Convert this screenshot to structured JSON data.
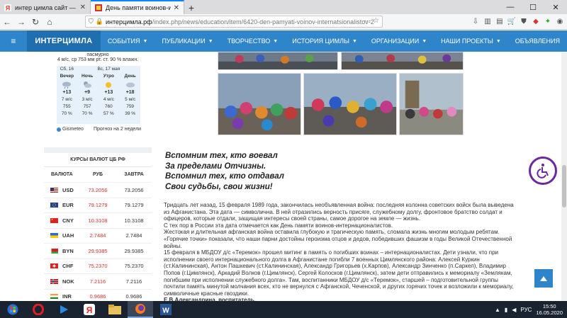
{
  "browser": {
    "tabs": [
      {
        "title": "интер цимла сайт — Яндекс: н",
        "active": false
      },
      {
        "title": "День памяти воинов-интернац",
        "active": true
      }
    ],
    "url_host": "интерцимла.рф",
    "url_path": "/index.php/news/education/item/6420-den-pamyati-voinov-internatsionalistov-2"
  },
  "site_menu": {
    "brand": "ИНТЕРЦИМЛА",
    "items": [
      "СОБЫТИЯ",
      "ПУБЛИКАЦИИ",
      "ТВОРЧЕСТВО",
      "ИСТОРИЯ ЦИМЛЫ",
      "ОРГАНИЗАЦИИ",
      "НАШИ ПРОЕКТЫ",
      "ОБЪЯВЛЕНИЯ"
    ]
  },
  "weather": {
    "now_condition": "пасмурно",
    "now_details": "4 м/с, ср   753 мм рт. ст.   90 % влажн.",
    "day1": "Сб, 16",
    "day2": "Вс, 17 мая",
    "columns": [
      {
        "period": "Вечер",
        "temp": "+13",
        "wind": "7 м/с",
        "pressure": "755",
        "humidity": "70 %",
        "icon": "cloud-rain-icon"
      },
      {
        "period": "Ночь",
        "temp": "+9",
        "wind": "3 м/с",
        "pressure": "757",
        "humidity": "70 %",
        "icon": "cloud-moon-icon"
      },
      {
        "period": "Утро",
        "temp": "+13",
        "wind": "4 м/с",
        "pressure": "760",
        "humidity": "57 %",
        "icon": "sun-icon"
      },
      {
        "period": "День",
        "temp": "+18",
        "wind": "5 м/с",
        "pressure": "759",
        "humidity": "39 %",
        "icon": "cloud-icon"
      }
    ],
    "provider": "Gismeteo",
    "forecast_link": "Прогноз на 2 недели"
  },
  "currency": {
    "title": "КУРСЫ ВАЛЮТ ЦБ РФ",
    "headers": [
      "ВАЛЮТА",
      "РУБ",
      "ЗАВТРА"
    ],
    "rows": [
      {
        "code": "USD",
        "rub": "73.2056",
        "tomorrow": "73.2056"
      },
      {
        "code": "EUR",
        "rub": "79.1279",
        "tomorrow": "79.1279"
      },
      {
        "code": "CNY",
        "rub": "10.3108",
        "tomorrow": "10.3108"
      },
      {
        "code": "UAH",
        "rub": "2.7484",
        "tomorrow": "2.7484"
      },
      {
        "code": "BYN",
        "rub": "29.9385",
        "tomorrow": "29.9385"
      },
      {
        "code": "CHF",
        "rub": "75.2370",
        "tomorrow": "75.2370"
      },
      {
        "code": "NOK",
        "rub": "7.2116",
        "tomorrow": "7.2116"
      },
      {
        "code": "INR",
        "rub": "0.9686",
        "tomorrow": "0.9686"
      }
    ]
  },
  "poem": [
    "Вспомним тех, кто воевал",
    "За пределами Отчизны.",
    "Вспомнил тех, кто отдавал",
    "Свои судьбы, свои жизни!"
  ],
  "article": [
    "Тридцать лет назад, 15 февраля 1989 года, закончилась необъявленная война: последняя колонна советских войск была выведена из Афганистана. Эта дата — символична. В ней отразились верность присяге, служебному долгу, фронтовое братство солдат и офицеров, которые отдали, защищая интересы своей страны, самое дорогое на земле — жизнь.",
    "С тех пор в России эта дата отмечается как День памяти воинов-интернационалистов.",
    "Жестокая и длительная афганская война оставила глубокую и трагическую память, сломала жизнь многим молодым ребятам. «Горячие точки» показали, что наши парни достойны героизма отцов и дедов, победивших фашизм в годы Великой Отечественной войны.",
    "15 февраля в МБДОУ д/с «Теремок» прошел митинг в память о погибших воинах – интернационалистах. Дети узнали, что при исполнении своего интернационального долга в Афганистане погибли 7 военных Цимлянского района: Алексей Куркин (ст.Калининская), Антон Пашкевич (ст.Калининская), Александр Григорьев (х.Карпов), Александр Зинченко (п.Саркел), Владимир Попов (г.Цимлянск), Аркадий Волков (г.Цимлянск), Сергей Колосков (г.Цимлянск), затем дети отправились к мемориалу «Землякам, погибшим при исполнении служебного долга». Там, воспитанники МБДОУ д/с «Теремок», старшей – подготовительной группы почтили память минутой молчания всех, кто не вернулся с Афганской, Чеченской, и других горячих точек и возложили к мемориалу, символичные красные гвоздики."
  ],
  "signature": "Е.В.Александрина, воспитатель.",
  "tray": {
    "lang": "РУС",
    "time": "15:50",
    "date": "16.05.2020"
  }
}
